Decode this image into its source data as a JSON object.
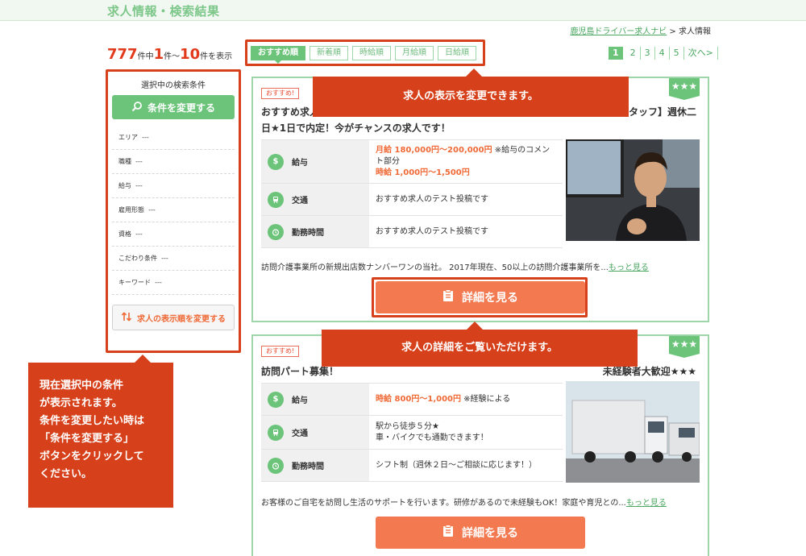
{
  "header": {
    "title": "求人情報・検索結果"
  },
  "breadcrumb": {
    "home": "鹿児島ドライバー求人ナビ",
    "sep": " > ",
    "current": "求人情報"
  },
  "count": {
    "total": "777",
    "t1": "件中",
    "from": "1",
    "t2": "件〜",
    "to": "10",
    "t3": "件を表示"
  },
  "sort": {
    "tabs": [
      "おすすめ順",
      "新着順",
      "時給順",
      "月給順",
      "日給順"
    ],
    "active_index": 0
  },
  "pager": {
    "pages": [
      "1",
      "2",
      "3",
      "4",
      "5"
    ],
    "current": "1",
    "next": "次へ>"
  },
  "sidebar": {
    "heading": "選択中の検索条件",
    "change_label": "条件を変更する",
    "conditions": [
      {
        "label": "エリア",
        "value": "---"
      },
      {
        "label": "職種",
        "value": "---"
      },
      {
        "label": "給与",
        "value": "---"
      },
      {
        "label": "雇用形態",
        "value": "---"
      },
      {
        "label": "資格",
        "value": "---"
      },
      {
        "label": "こだわり条件",
        "value": "---"
      },
      {
        "label": "キーワード",
        "value": "---"
      }
    ],
    "sort_label": "求人の表示順を変更する"
  },
  "callouts": {
    "side": [
      "現在選択中の条件",
      "が表示されます。",
      "条件を変更したい時は",
      "「条件を変更する」",
      "ボタンをクリックして",
      "ください。"
    ],
    "top": "求人の表示を変更できます。",
    "mid": "求人の詳細をご覧いただけます。"
  },
  "jobs": [
    {
      "tag": "おすすめ!",
      "stars": "★★★",
      "title_start": "おすすめ求人",
      "title_end": "タッフ】週休二",
      "title_line2": "日★1日で内定！今がチャンスの求人です！",
      "rows": {
        "salary_key": "給与",
        "salary_monthly": "月給 180,000円〜200,000円",
        "salary_comment": " ※給与のコメント部分",
        "salary_hourly": "時給 1,000円〜1,500円",
        "access_key": "交通",
        "access_val": "おすすめ求人のテスト投稿です",
        "hours_key": "勤務時間",
        "hours_val": "おすすめ求人のテスト投稿です"
      },
      "desc": "訪問介護事業所の新規出店数ナンバーワンの当社。 2017年現在、50以上の訪問介護事業所を...",
      "more": "もっと見る",
      "detail_label": "詳細を見る"
    },
    {
      "tag": "おすすめ!",
      "stars": "★★★",
      "title_start": "訪問パート募集！",
      "title_end": "未経験者大歓迎★★★",
      "rows": {
        "salary_key": "給与",
        "salary_hourly": "時給 800円〜1,000円",
        "salary_comment": " ※経験による",
        "access_key": "交通",
        "access_line1": "駅から徒歩５分★",
        "access_line2": "車・バイクでも通勤できます！",
        "hours_key": "勤務時間",
        "hours_val": "シフト制（週休２日〜ご相談に応じます！）"
      },
      "desc": "お客様のご自宅を訪問し生活のサポートを行います。研修があるので未経験もOK！家庭や育児との...",
      "more": "もっと見る",
      "detail_label": "詳細を見る"
    }
  ],
  "colors": {
    "green": "#6cc47a",
    "orange": "#f27950",
    "annotation": "#d6401a"
  }
}
